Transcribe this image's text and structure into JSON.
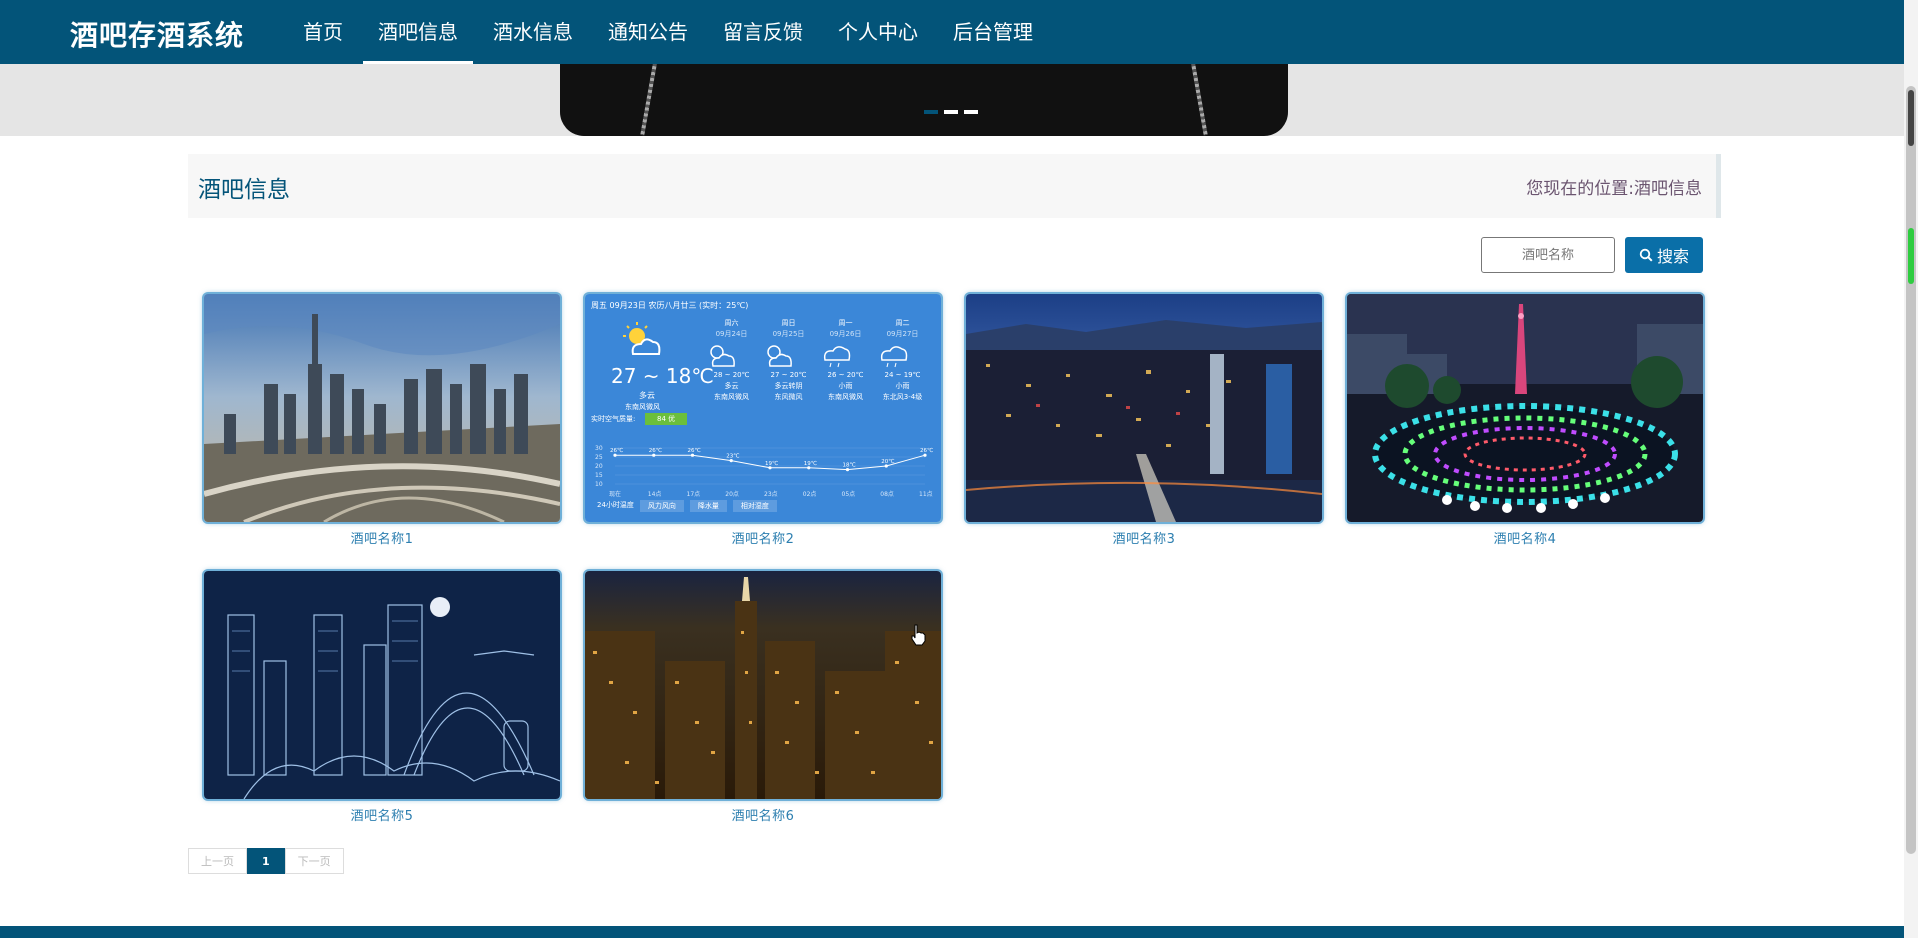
{
  "app": {
    "title": "酒吧存酒系统"
  },
  "nav": {
    "items": [
      {
        "label": "首页"
      },
      {
        "label": "酒吧信息",
        "active": true
      },
      {
        "label": "酒水信息"
      },
      {
        "label": "通知公告"
      },
      {
        "label": "留言反馈"
      },
      {
        "label": "个人中心"
      },
      {
        "label": "后台管理"
      }
    ]
  },
  "page": {
    "title": "酒吧信息",
    "location_prefix": "您现在的位置:",
    "location": "酒吧信息"
  },
  "search": {
    "placeholder": "酒吧名称",
    "button_label": "搜索"
  },
  "cards": [
    {
      "name": "酒吧名称1",
      "image": "city-skyline-day"
    },
    {
      "name": "酒吧名称2",
      "image": "weather-forecast"
    },
    {
      "name": "酒吧名称3",
      "image": "city-night-river"
    },
    {
      "name": "酒吧名称4",
      "image": "tower-fountain-night"
    },
    {
      "name": "酒吧名称5",
      "image": "line-art-city"
    },
    {
      "name": "酒吧名称6",
      "image": "city-night-aerial"
    }
  ],
  "weather": {
    "header": "周五 09月23日 农历八月廿三 (实时：25℃)",
    "temp": "27 ~ 18℃",
    "condition": "多云",
    "wind": "东南风微风",
    "aqi_label": "实时空气质量:",
    "aqi": "84 优",
    "days": [
      {
        "name": "周六",
        "date": "09月24日",
        "temp": "28 ~ 20℃",
        "cond": "多云",
        "wind": "东南风微风"
      },
      {
        "name": "周日",
        "date": "09月25日",
        "temp": "27 ~ 20℃",
        "cond": "多云转阴",
        "wind": "东风微风"
      },
      {
        "name": "周一",
        "date": "09月26日",
        "temp": "26 ~ 20℃",
        "cond": "小雨",
        "wind": "东南风微风"
      },
      {
        "name": "周二",
        "date": "09月27日",
        "temp": "24 ~ 19℃",
        "cond": "小雨",
        "wind": "东北风3-4级"
      }
    ],
    "hour_labels": [
      "现在",
      "14点",
      "17点",
      "20点",
      "23点",
      "02点",
      "05点",
      "08点",
      "11点"
    ],
    "hour_temps": [
      26,
      26,
      26,
      23,
      19,
      19,
      18,
      20,
      26
    ],
    "axis_ticks": [
      "30",
      "25",
      "20",
      "15",
      "10"
    ],
    "tabs": [
      "24小时温度",
      "风力风向",
      "降水量",
      "相对湿度"
    ]
  },
  "pagination": {
    "prev": "上一页",
    "current": "1",
    "next": "下一页"
  },
  "colors": {
    "primary": "#035479",
    "button": "#0a6fa8",
    "link": "#2d7fb0"
  }
}
